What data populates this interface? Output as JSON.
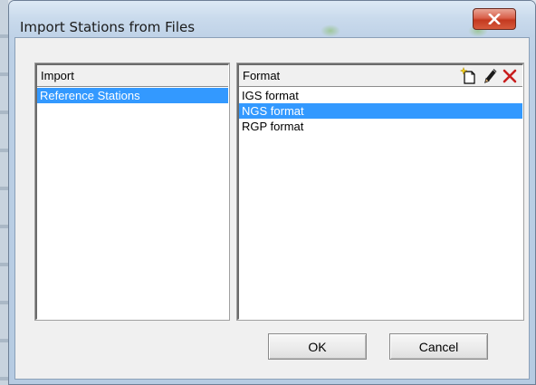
{
  "window": {
    "title": "Import Stations from Files",
    "close_icon": "close-icon"
  },
  "import_panel": {
    "header": "Import",
    "items": [
      {
        "label": "Reference Stations",
        "selected": true
      }
    ]
  },
  "format_panel": {
    "header": "Format",
    "toolbar": [
      "new-file-icon",
      "pencil-icon",
      "delete-x-icon"
    ],
    "items": [
      {
        "label": "IGS format",
        "selected": false
      },
      {
        "label": "NGS format",
        "selected": true
      },
      {
        "label": "RGP format",
        "selected": false
      }
    ]
  },
  "buttons": {
    "ok": "OK",
    "cancel": "Cancel"
  },
  "colors": {
    "selection": "#3399ff",
    "delete_icon": "#c81e1e",
    "close_button": "#c4391f"
  }
}
